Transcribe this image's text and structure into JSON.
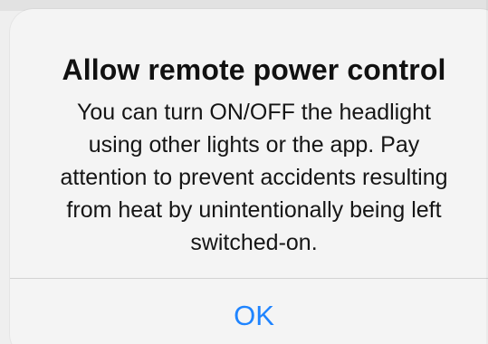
{
  "alert": {
    "title": "Allow remote power control",
    "message_lines": [
      "You can turn ON/OFF the headlight",
      "using other lights or the app. Pay",
      "attention to prevent accidents resulting",
      "from heat by unintentionally being left",
      "switched-on."
    ],
    "ok_label": "OK"
  },
  "colors": {
    "background": "#efefef",
    "dialog_background": "#f4f4f4",
    "title_text": "#111111",
    "message_text": "#151515",
    "button_text": "#1f84ff",
    "divider": "#d3d3d3"
  }
}
